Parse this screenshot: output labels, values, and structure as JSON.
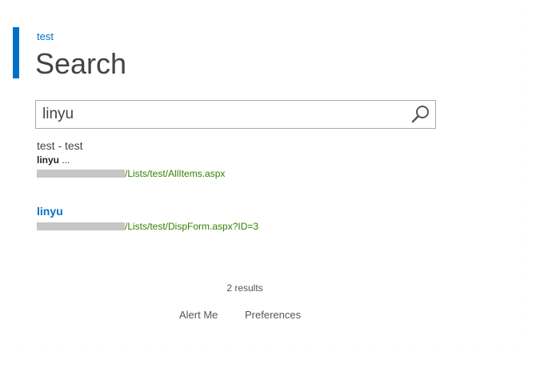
{
  "site": {
    "breadcrumb": "test"
  },
  "page": {
    "title": "Search"
  },
  "search": {
    "value": "linyu",
    "button_icon": "search-icon"
  },
  "results": [
    {
      "title": "test - test",
      "snippet_bold": "linyu",
      "snippet_rest": " ...",
      "url_path": "/Lists/test/AllItems.aspx"
    },
    {
      "title": "linyu",
      "url_path": "/Lists/test/DispForm.aspx?ID=3"
    }
  ],
  "summary": {
    "count_text": "2 results"
  },
  "footer": {
    "alert_me": "Alert Me",
    "preferences": "Preferences"
  },
  "colors": {
    "accent": "#0072c6",
    "url_green": "#338200",
    "text": "#444444"
  }
}
